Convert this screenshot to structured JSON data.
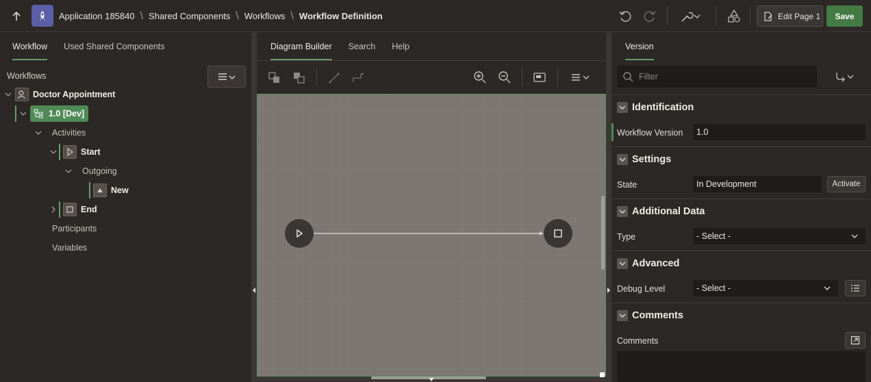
{
  "header": {
    "breadcrumbs": [
      "Application 185840",
      "Shared Components",
      "Workflows",
      "Workflow Definition"
    ],
    "edit_page_label": "Edit Page 1",
    "save_label": "Save",
    "icons": [
      "up-arrow-icon",
      "undo-icon",
      "redo-icon",
      "wrench-icon",
      "shapes-icon"
    ]
  },
  "left": {
    "tabs": [
      "Workflow",
      "Used Shared Components"
    ],
    "section_label": "Workflows",
    "tree": {
      "root": "Doctor Appointment",
      "version": "1.0 [Dev]",
      "activities": "Activities",
      "start": "Start",
      "outgoing": "Outgoing",
      "new": "New",
      "end": "End",
      "participants": "Participants",
      "variables": "Variables"
    }
  },
  "center": {
    "tabs": [
      "Diagram Builder",
      "Search",
      "Help"
    ]
  },
  "right": {
    "tab": "Version",
    "filter_placeholder": "Filter",
    "sections": {
      "identification": "Identification",
      "settings": "Settings",
      "additional_data": "Additional Data",
      "advanced": "Advanced",
      "comments": "Comments"
    },
    "fields": {
      "workflow_version_label": "Workflow Version",
      "workflow_version_value": "1.0",
      "state_label": "State",
      "state_value": "In Development",
      "activate_label": "Activate",
      "type_label": "Type",
      "type_value": "- Select -",
      "debug_label": "Debug Level",
      "debug_value": "- Select -",
      "comments_label": "Comments"
    }
  },
  "colors": {
    "accent_green": "#447a44",
    "version_node_green": "#4f8a57",
    "app_icon": "#5b5ea6"
  }
}
